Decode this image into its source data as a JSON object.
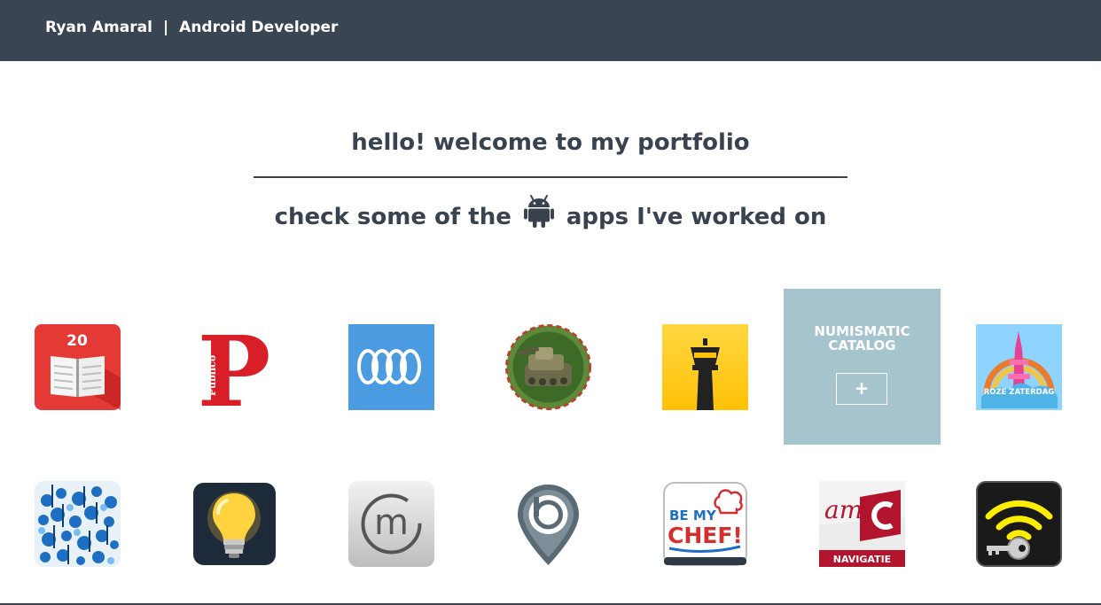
{
  "header": {
    "name": "Ryan Amaral",
    "separator": "|",
    "role": "Android Developer"
  },
  "main": {
    "headline": "hello! welcome to my portfolio",
    "sub_before": "check some of the",
    "sub_after": "apps I've worked on"
  },
  "apps": [
    {
      "icon": "book-20-icon",
      "badge": "20"
    },
    {
      "icon": "publico-icon",
      "letter": "P",
      "brand": "Público"
    },
    {
      "icon": "spring-coil-icon"
    },
    {
      "icon": "tank-icon"
    },
    {
      "icon": "control-tower-icon"
    },
    {
      "icon": "numismatic-catalog-icon",
      "title": "NUMISMATIC CATALOG",
      "button": "+"
    },
    {
      "icon": "roze-zaterdag-icon",
      "caption": "ROZE ZATERDAG"
    },
    {
      "icon": "music-notes-icon"
    },
    {
      "icon": "lightbulb-icon"
    },
    {
      "icon": "m-circle-icon",
      "letter": "m"
    },
    {
      "icon": "map-pin-icon"
    },
    {
      "icon": "be-my-chef-icon",
      "line1": "BE MY",
      "line2": "CHEF!"
    },
    {
      "icon": "amc-navigatie-icon",
      "mark": "am",
      "caption": "NAVIGATIE"
    },
    {
      "icon": "wifi-key-icon"
    }
  ],
  "colors": {
    "header_bg": "#3a4554",
    "text": "#394350",
    "hover_overlay": "#a6c4ce"
  }
}
